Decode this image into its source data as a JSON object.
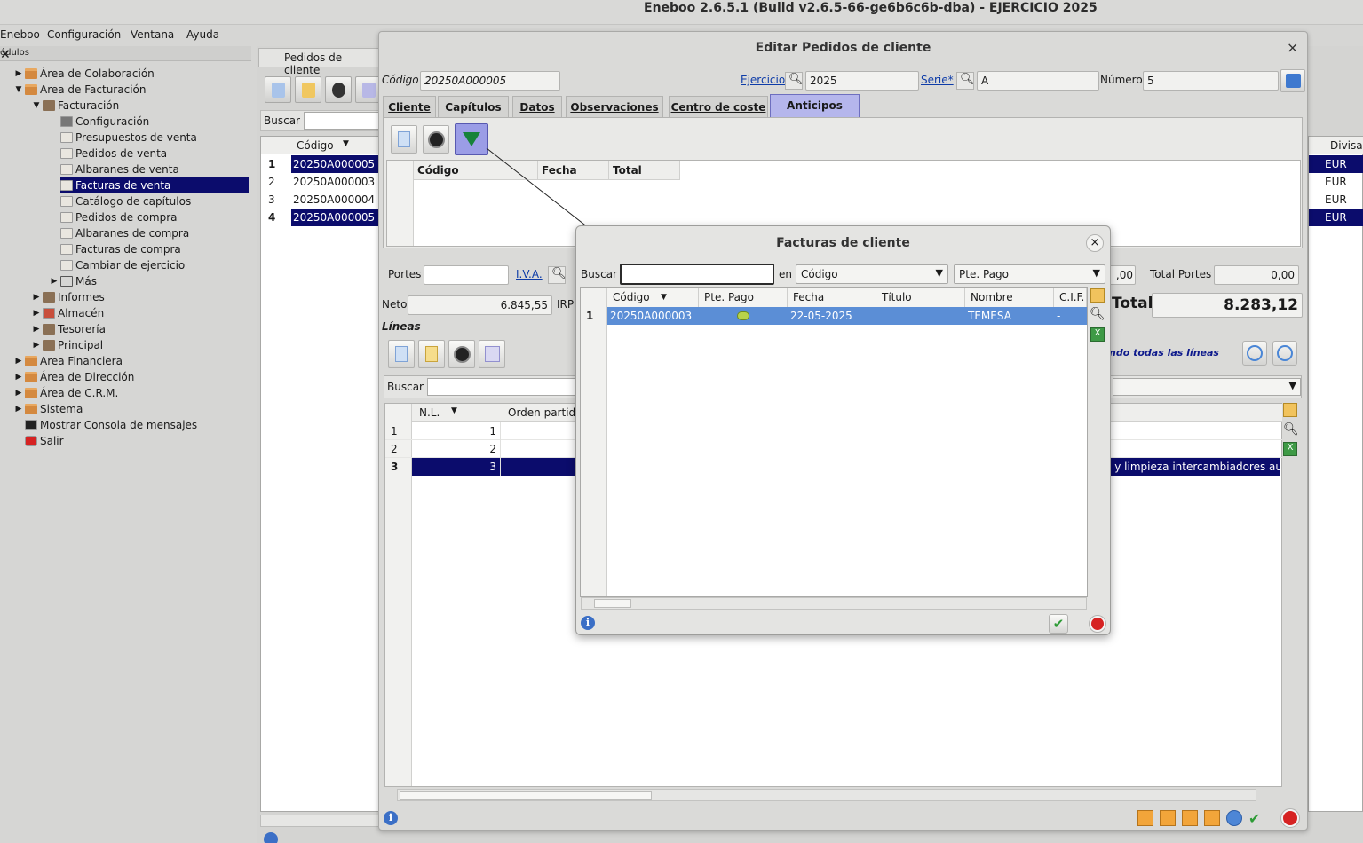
{
  "window_title": "Eneboo 2.6.5.1 (Build v2.6.5-66-ge6b6c6b-dba) - EJERCICIO 2025",
  "menu": [
    "Eneboo",
    "Configuración",
    "Ventana",
    "Ayuda"
  ],
  "modules": {
    "header": "ódulos",
    "close": "✕",
    "items": [
      {
        "label": "Área de Colaboración",
        "level": 0,
        "expanded": false,
        "icon": "folder-icon"
      },
      {
        "label": "Area de Facturación",
        "level": 0,
        "expanded": true,
        "icon": "folder-icon"
      },
      {
        "label": "Facturación",
        "level": 1,
        "expanded": true,
        "icon": "gear-icon"
      },
      {
        "label": "Configuración",
        "level": 2,
        "icon": "wrench-icon"
      },
      {
        "label": "Presupuestos de venta",
        "level": 2,
        "icon": "document-icon"
      },
      {
        "label": "Pedidos de venta",
        "level": 2,
        "icon": "document-icon"
      },
      {
        "label": "Albaranes de venta",
        "level": 2,
        "icon": "document-icon"
      },
      {
        "label": "Facturas de venta",
        "level": 2,
        "icon": "document-icon",
        "selected": true
      },
      {
        "label": "Catálogo de capítulos",
        "level": 2,
        "icon": "document-icon"
      },
      {
        "label": "Pedidos de compra",
        "level": 2,
        "icon": "document-icon"
      },
      {
        "label": "Albaranes de compra",
        "level": 2,
        "icon": "document-icon"
      },
      {
        "label": "Facturas de compra",
        "level": 2,
        "icon": "document-icon"
      },
      {
        "label": "Cambiar de ejercicio",
        "level": 2,
        "icon": "document-icon"
      },
      {
        "label": "Más",
        "level": 2,
        "expanded": false,
        "icon": "plus-icon"
      },
      {
        "label": "Informes",
        "level": 1,
        "expanded": false,
        "icon": "gear-icon"
      },
      {
        "label": "Almacén",
        "level": 1,
        "expanded": false,
        "icon": "box-icon"
      },
      {
        "label": "Tesorería",
        "level": 1,
        "expanded": false,
        "icon": "gear-icon"
      },
      {
        "label": "Principal",
        "level": 1,
        "expanded": false,
        "icon": "gear-icon"
      },
      {
        "label": "Area Financiera",
        "level": 0,
        "expanded": false,
        "icon": "folder-icon"
      },
      {
        "label": "Área de Dirección",
        "level": 0,
        "expanded": false,
        "icon": "folder-icon"
      },
      {
        "label": "Área de C.R.M.",
        "level": 0,
        "expanded": false,
        "icon": "folder-icon"
      },
      {
        "label": "Sistema",
        "level": 0,
        "expanded": false,
        "icon": "folder-icon"
      },
      {
        "label": "Mostrar Consola de mensajes",
        "level": 0,
        "icon": "terminal-icon"
      },
      {
        "label": "Salir",
        "level": 0,
        "icon": "power-icon"
      }
    ]
  },
  "bg_window": {
    "tab": "Pedidos de cliente",
    "search_label": "Buscar",
    "column_codigo": "Código",
    "column_divisa": "Divisa",
    "rows": [
      {
        "n": "1",
        "codigo": "20250A000005",
        "divisa": "EUR",
        "selected": true
      },
      {
        "n": "2",
        "codigo": "20250A000003",
        "divisa": "EUR",
        "selected": false
      },
      {
        "n": "3",
        "codigo": "20250A000004",
        "divisa": "EUR",
        "selected": false
      },
      {
        "n": "4",
        "codigo": "20250A000005",
        "divisa": "EUR",
        "selected": true
      }
    ]
  },
  "edit_dialog": {
    "title": "Editar Pedidos de cliente",
    "close": "×",
    "codigo_label": "Código",
    "codigo_value": "20250A000005",
    "ejercicio_label": "Ejercicio",
    "ejercicio_value": "2025",
    "serie_label": "Serie*",
    "serie_value": "A",
    "numero_label": "Número",
    "numero_value": "5",
    "tabs": [
      "Cliente",
      "Capítulos",
      "Datos",
      "Observaciones",
      "Centro de coste",
      "Anticipos"
    ],
    "active_tab": "Anticipos",
    "anticipos_columns": [
      "Código",
      "Fecha",
      "Total"
    ],
    "portes_label": "Portes",
    "iva_label": "I.V.A.",
    "portes_partial": ",00",
    "total_portes_label": "Total Portes",
    "total_portes_value": "0,00",
    "neto_label": "Neto",
    "neto_value": "6.845,55",
    "irpf_label": "IRP",
    "total_label": "Total",
    "total_value": "8.283,12",
    "lineas_label": "Líneas",
    "lineas_hint": "ndo todas las líneas",
    "buscar_label": "Buscar",
    "lineas_columns": [
      "N.L.",
      "Orden partida"
    ],
    "lineas_rows": [
      {
        "n": "1",
        "nl": "1",
        "text": "",
        "selected": false
      },
      {
        "n": "2",
        "nl": "2",
        "text": "",
        "selected": false
      },
      {
        "n": "3",
        "nl": "3",
        "text": "e y limpieza intercambiadores au",
        "selected": true
      }
    ]
  },
  "facturas_dialog": {
    "title": "Facturas de cliente",
    "close": "×",
    "buscar_label": "Buscar",
    "search_value": "",
    "en_label": "en",
    "field_select": "Código",
    "filter_select": "Pte. Pago",
    "columns": [
      "Código",
      "Pte. Pago",
      "Fecha",
      "Título",
      "Nombre",
      "C.I.F."
    ],
    "rows": [
      {
        "n": "1",
        "codigo": "20250A000003",
        "pte_pago": "pending-dot-icon",
        "fecha": "22-05-2025",
        "titulo": "",
        "nombre": "TEMESA",
        "cif": "-"
      }
    ]
  },
  "colors": {
    "selection_navy": "#0b0c6c",
    "selection_blue": "#5b8ed6",
    "active_tab": "#b5b6ec"
  }
}
